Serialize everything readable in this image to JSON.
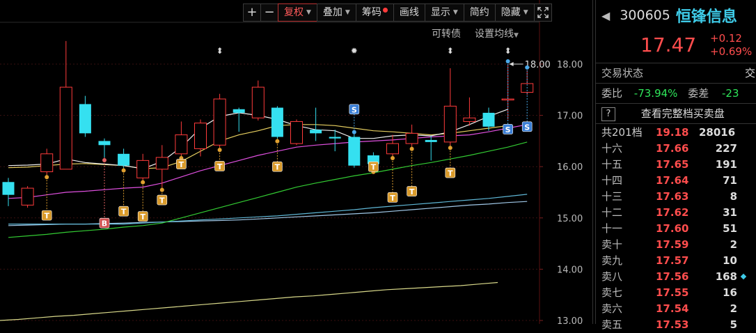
{
  "toolbar": {
    "zoom_in": "+",
    "zoom_out": "−",
    "rights": "复权",
    "overlay": "叠加",
    "chips": "筹码",
    "draw": "画线",
    "display": "显示",
    "simple": "简约",
    "hide": "隐藏",
    "fullscreen_icon": "expand-icon"
  },
  "subbar": {
    "convertible": "可转债",
    "ma_settings": "设置均线"
  },
  "chart_data": {
    "type": "candlestick",
    "y_ticks": [
      "18.00",
      "17.00",
      "16.00",
      "15.00",
      "14.00",
      "13.00"
    ],
    "ylim": [
      12.95,
      18.55
    ],
    "high_annotation": "18.00",
    "candles": [
      {
        "o": 15.7,
        "c": 15.45,
        "h": 15.78,
        "l": 15.23,
        "up": false
      },
      {
        "o": 15.25,
        "c": 15.58,
        "h": 15.62,
        "l": 15.2,
        "up": true
      },
      {
        "o": 15.9,
        "c": 16.25,
        "h": 16.35,
        "l": 15.85,
        "up": true
      },
      {
        "o": 15.95,
        "c": 17.55,
        "h": 18.45,
        "l": 15.95,
        "up": true
      },
      {
        "o": 17.22,
        "c": 16.65,
        "h": 17.38,
        "l": 16.58,
        "up": false
      },
      {
        "o": 16.5,
        "c": 16.42,
        "h": 16.55,
        "l": 16.18,
        "up": false
      },
      {
        "o": 16.25,
        "c": 16.02,
        "h": 16.35,
        "l": 15.98,
        "up": false
      },
      {
        "o": 15.78,
        "c": 16.12,
        "h": 16.25,
        "l": 15.75,
        "up": true
      },
      {
        "o": 15.95,
        "c": 16.18,
        "h": 16.42,
        "l": 15.6,
        "up": true
      },
      {
        "o": 16.25,
        "c": 16.62,
        "h": 16.88,
        "l": 16.22,
        "up": true
      },
      {
        "o": 16.35,
        "c": 16.85,
        "h": 16.92,
        "l": 16.2,
        "up": true
      },
      {
        "o": 16.42,
        "c": 17.32,
        "h": 17.42,
        "l": 16.38,
        "up": true
      },
      {
        "o": 17.12,
        "c": 17.05,
        "h": 17.15,
        "l": 16.68,
        "up": false
      },
      {
        "o": 16.95,
        "c": 17.55,
        "h": 17.68,
        "l": 16.9,
        "up": true
      },
      {
        "o": 17.15,
        "c": 16.58,
        "h": 17.18,
        "l": 16.55,
        "up": false
      },
      {
        "o": 16.45,
        "c": 16.88,
        "h": 16.92,
        "l": 16.42,
        "up": true
      },
      {
        "o": 16.72,
        "c": 16.65,
        "h": 17.15,
        "l": 16.5,
        "up": false
      },
      {
        "o": 16.58,
        "c": 16.55,
        "h": 16.72,
        "l": 16.3,
        "up": false
      },
      {
        "o": 16.58,
        "c": 16.02,
        "h": 16.62,
        "l": 15.98,
        "up": false
      },
      {
        "o": 16.22,
        "c": 16.05,
        "h": 16.28,
        "l": 15.95,
        "up": true
      },
      {
        "o": 16.25,
        "c": 16.45,
        "h": 16.62,
        "l": 16.22,
        "up": true
      },
      {
        "o": 16.45,
        "c": 16.65,
        "h": 16.82,
        "l": 16.4,
        "up": true
      },
      {
        "o": 16.52,
        "c": 16.48,
        "h": 16.6,
        "l": 16.12,
        "up": false
      },
      {
        "o": 16.48,
        "c": 17.18,
        "h": 17.92,
        "l": 16.42,
        "up": true
      },
      {
        "o": 16.88,
        "c": 16.95,
        "h": 17.35,
        "l": 16.8,
        "up": true
      },
      {
        "o": 17.05,
        "c": 16.78,
        "h": 17.15,
        "l": 16.7,
        "up": false
      },
      {
        "o": 17.3,
        "c": 17.32,
        "h": 18.0,
        "l": 16.92,
        "up": true
      },
      {
        "o": 17.45,
        "c": 17.62,
        "h": 17.88,
        "l": 17.4,
        "up": false
      }
    ],
    "ma5": [
      16.02,
      16.03,
      16.05,
      16.15,
      16.08,
      16.05,
      16.02,
      15.96,
      16.1,
      16.38,
      16.75,
      16.98,
      17.05,
      17.0,
      16.92,
      16.8,
      16.72,
      16.7,
      16.55,
      16.55,
      16.6,
      16.62,
      16.6,
      16.68,
      16.82,
      16.98,
      17.12
    ],
    "ma10": [
      15.98,
      15.99,
      16.02,
      16.05,
      16.06,
      16.04,
      16.02,
      15.96,
      15.98,
      16.1,
      16.3,
      16.5,
      16.62,
      16.7,
      16.8,
      16.82,
      16.82,
      16.8,
      16.75,
      16.7,
      16.68,
      16.65,
      16.62,
      16.65,
      16.7,
      16.75,
      16.8
    ],
    "ma20": [
      15.38,
      15.4,
      15.45,
      15.5,
      15.52,
      15.55,
      15.58,
      15.6,
      15.68,
      15.8,
      15.92,
      16.02,
      16.12,
      16.22,
      16.3,
      16.38,
      16.42,
      16.45,
      16.48,
      16.5,
      16.52,
      16.55,
      16.58,
      16.6,
      16.62,
      16.68,
      16.75,
      16.82
    ],
    "ma60": [
      14.62,
      14.65,
      14.68,
      14.72,
      14.75,
      14.78,
      14.82,
      14.85,
      14.9,
      15.0,
      15.1,
      15.2,
      15.3,
      15.4,
      15.5,
      15.6,
      15.68,
      15.75,
      15.82,
      15.88,
      15.95,
      16.02,
      16.08,
      16.15,
      16.22,
      16.3,
      16.38,
      16.48
    ],
    "ma120": [
      14.88,
      14.88,
      14.88,
      14.88,
      14.88,
      14.88,
      14.88,
      14.9,
      14.92,
      14.94,
      14.96,
      14.98,
      15.0,
      15.02,
      15.04,
      15.07,
      15.1,
      15.13,
      15.16,
      15.2,
      15.23,
      15.26,
      15.29,
      15.32,
      15.35,
      15.38,
      15.42,
      15.46
    ],
    "ma240": [
      14.85,
      14.86,
      14.87,
      14.88,
      14.88,
      14.89,
      14.9,
      14.91,
      14.92,
      14.93,
      14.94,
      14.95,
      14.96,
      14.98,
      15.0,
      15.02,
      15.04,
      15.06,
      15.08,
      15.1,
      15.13,
      15.16,
      15.19,
      15.22,
      15.25,
      15.27,
      15.3,
      15.32
    ],
    "ma_long": [
      13.0,
      13.02,
      13.05,
      13.08,
      13.1,
      13.13,
      13.16,
      13.19,
      13.22,
      13.25,
      13.28,
      13.31,
      13.34,
      13.37,
      13.4,
      13.43,
      13.46,
      13.48,
      13.51,
      13.54,
      13.57,
      13.6,
      13.62,
      13.64,
      13.66,
      13.68,
      13.71,
      13.74
    ],
    "markers": [
      {
        "i": 2,
        "label": "T",
        "y": 15.05
      },
      {
        "i": 5,
        "label": "B",
        "y": 14.9
      },
      {
        "i": 6,
        "label": "T",
        "y": 15.13
      },
      {
        "i": 7,
        "label": "T",
        "y": 15.03
      },
      {
        "i": 8,
        "label": "T",
        "y": 15.35
      },
      {
        "i": 9,
        "label": "T",
        "y": 16.05
      },
      {
        "i": 11,
        "label": "T",
        "y": 16.01
      },
      {
        "i": 14,
        "label": "T",
        "y": 16.0
      },
      {
        "i": 18,
        "label": "S",
        "y": 17.12
      },
      {
        "i": 19,
        "label": "T",
        "y": 16.0
      },
      {
        "i": 20,
        "label": "T",
        "y": 15.4
      },
      {
        "i": 21,
        "label": "T",
        "y": 15.52
      },
      {
        "i": 23,
        "label": "T",
        "y": 15.88
      },
      {
        "i": 26,
        "label": "S",
        "y": 16.73
      },
      {
        "i": 27,
        "label": "S",
        "y": 16.78
      }
    ],
    "top_marks": [
      {
        "i": 11,
        "glyph": "⬍"
      },
      {
        "i": 18,
        "glyph": "✹"
      },
      {
        "i": 23,
        "glyph": "⬍"
      },
      {
        "i": 26,
        "glyph": "⬍"
      }
    ]
  },
  "panel": {
    "back_icon": "caret-left-icon",
    "code": "300605",
    "name": "恒锋信息",
    "price": "17.47",
    "change": "+0.12",
    "change_pct": "+0.69%",
    "trade_status_label": "交易状态",
    "trade_status_value": "交",
    "weibi_label": "委比",
    "weibi_value": "-73.94%",
    "weicha_label": "委差",
    "weicha_value": "-23",
    "help": "?",
    "view_full": "查看完整档买卖盘",
    "total_label": "共201档",
    "total_price": "19.18",
    "total_vol": "28016",
    "levels": [
      {
        "lvl": "十六",
        "px": "17.66",
        "vol": "227"
      },
      {
        "lvl": "十五",
        "px": "17.65",
        "vol": "191"
      },
      {
        "lvl": "十四",
        "px": "17.64",
        "vol": "71"
      },
      {
        "lvl": "十三",
        "px": "17.63",
        "vol": "8"
      },
      {
        "lvl": "十二",
        "px": "17.62",
        "vol": "31"
      },
      {
        "lvl": "十一",
        "px": "17.60",
        "vol": "51"
      },
      {
        "lvl": "卖十",
        "px": "17.59",
        "vol": "2"
      },
      {
        "lvl": "卖九",
        "px": "17.57",
        "vol": "10"
      },
      {
        "lvl": "卖八",
        "px": "17.56",
        "vol": "168",
        "mark": true
      },
      {
        "lvl": "卖七",
        "px": "17.55",
        "vol": "16"
      },
      {
        "lvl": "卖六",
        "px": "17.54",
        "vol": "2"
      },
      {
        "lvl": "卖五",
        "px": "17.53",
        "vol": "5"
      }
    ]
  }
}
